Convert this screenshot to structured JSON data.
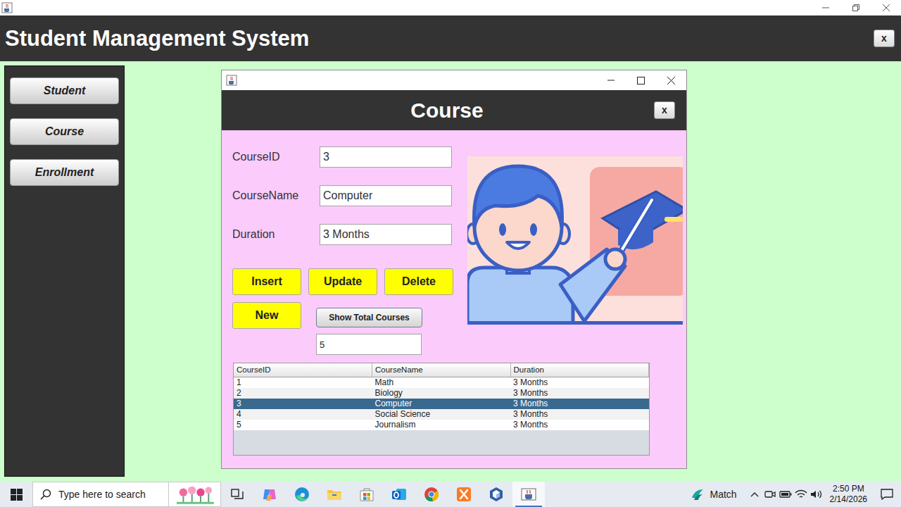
{
  "app": {
    "title": "Student Management System",
    "close_button": "x"
  },
  "sidebar": {
    "items": [
      {
        "label": "Student"
      },
      {
        "label": "Course"
      },
      {
        "label": "Enrollment"
      }
    ]
  },
  "course_window": {
    "title": "Course",
    "close_button": "x",
    "fields": [
      {
        "label": "CourseID",
        "value": "3"
      },
      {
        "label": "CourseName",
        "value": "Computer"
      },
      {
        "label": "Duration",
        "value": "3 Months"
      }
    ],
    "buttons": [
      "Insert",
      "Update",
      "Delete",
      "New"
    ],
    "total_button": "Show Total Courses",
    "total_value": "5"
  },
  "table": {
    "columns": [
      "CourseID",
      "CourseName",
      "Duration"
    ],
    "rows": [
      {
        "cells": [
          "1",
          "Math",
          "3 Months"
        ],
        "selected": false
      },
      {
        "cells": [
          "2",
          "Biology",
          "3 Months"
        ],
        "selected": false
      },
      {
        "cells": [
          "3",
          "Computer",
          "3 Months"
        ],
        "selected": true
      },
      {
        "cells": [
          "4",
          "Social Science",
          "3 Months"
        ],
        "selected": false
      },
      {
        "cells": [
          "5",
          "Journalism",
          "3 Months"
        ],
        "selected": false
      }
    ]
  },
  "taskbar": {
    "search_placeholder": "Type here to search",
    "weather": "Match",
    "time": "2:50 PM",
    "date": "2/14/2026"
  }
}
